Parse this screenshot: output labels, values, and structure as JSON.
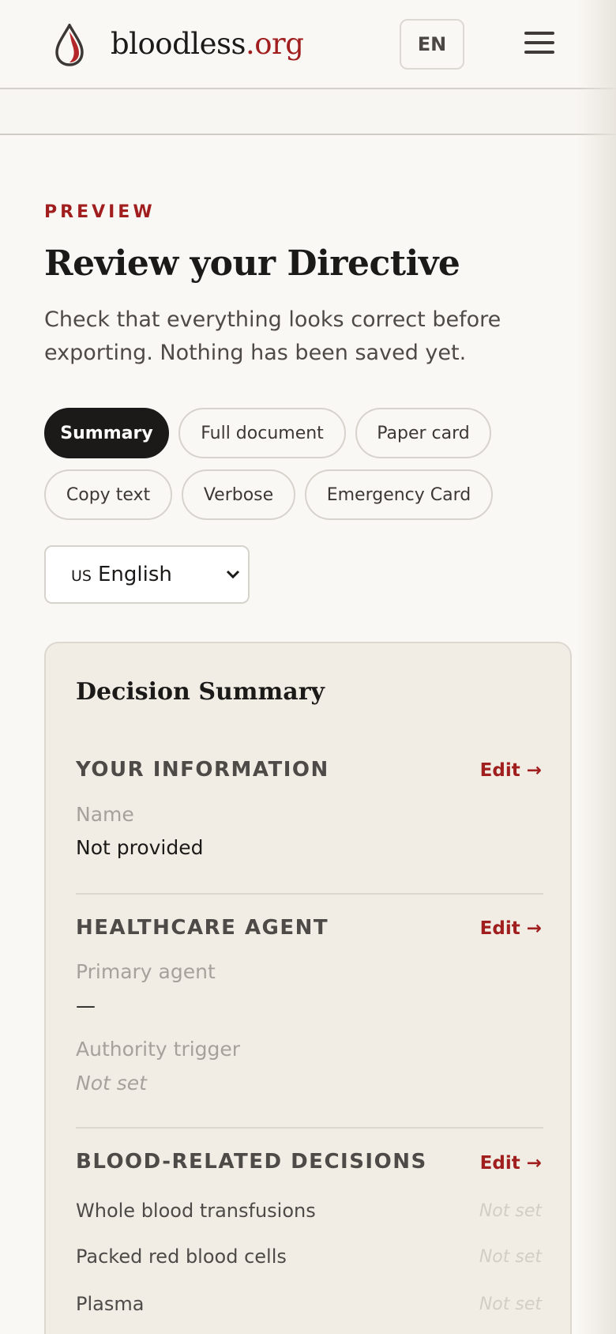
{
  "header": {
    "brand_name": "bloodless",
    "brand_tld": ".org",
    "language_button": "EN",
    "logo_icon": "blood-drop-icon",
    "menu_icon": "hamburger-menu-icon"
  },
  "intro": {
    "eyebrow": "PREVIEW",
    "title": "Review your Directive",
    "description": "Check that everything looks correct before exporting. Nothing has been saved yet."
  },
  "tabs": [
    {
      "label": "Summary",
      "active": true
    },
    {
      "label": "Full document",
      "active": false
    },
    {
      "label": "Paper card",
      "active": false
    },
    {
      "label": "Copy text",
      "active": false
    },
    {
      "label": "Verbose",
      "active": false
    },
    {
      "label": "Emergency Card",
      "active": false
    }
  ],
  "language_select": {
    "flag": "US",
    "selected": "English",
    "icon": "chevron-down-icon"
  },
  "summary_card": {
    "title": "Decision Summary",
    "sections": {
      "your_information": {
        "heading": "YOUR INFORMATION",
        "edit": "Edit →",
        "name_label": "Name",
        "name_value": "Not provided"
      },
      "healthcare_agent": {
        "heading": "HEALTHCARE AGENT",
        "edit": "Edit →",
        "primary_label": "Primary agent",
        "primary_value": "—",
        "trigger_label": "Authority trigger",
        "trigger_value": "Not set"
      },
      "blood_decisions": {
        "heading": "BLOOD-RELATED DECISIONS",
        "edit": "Edit →",
        "rows": [
          {
            "label": "Whole blood transfusions",
            "value": "Not set"
          },
          {
            "label": "Packed red blood cells",
            "value": "Not set"
          },
          {
            "label": "Plasma",
            "value": "Not set"
          }
        ]
      }
    }
  },
  "colors": {
    "accent": "#a01e1e",
    "background": "#faf8f4",
    "card": "#f1ede5",
    "active_tab": "#1c1a18"
  }
}
